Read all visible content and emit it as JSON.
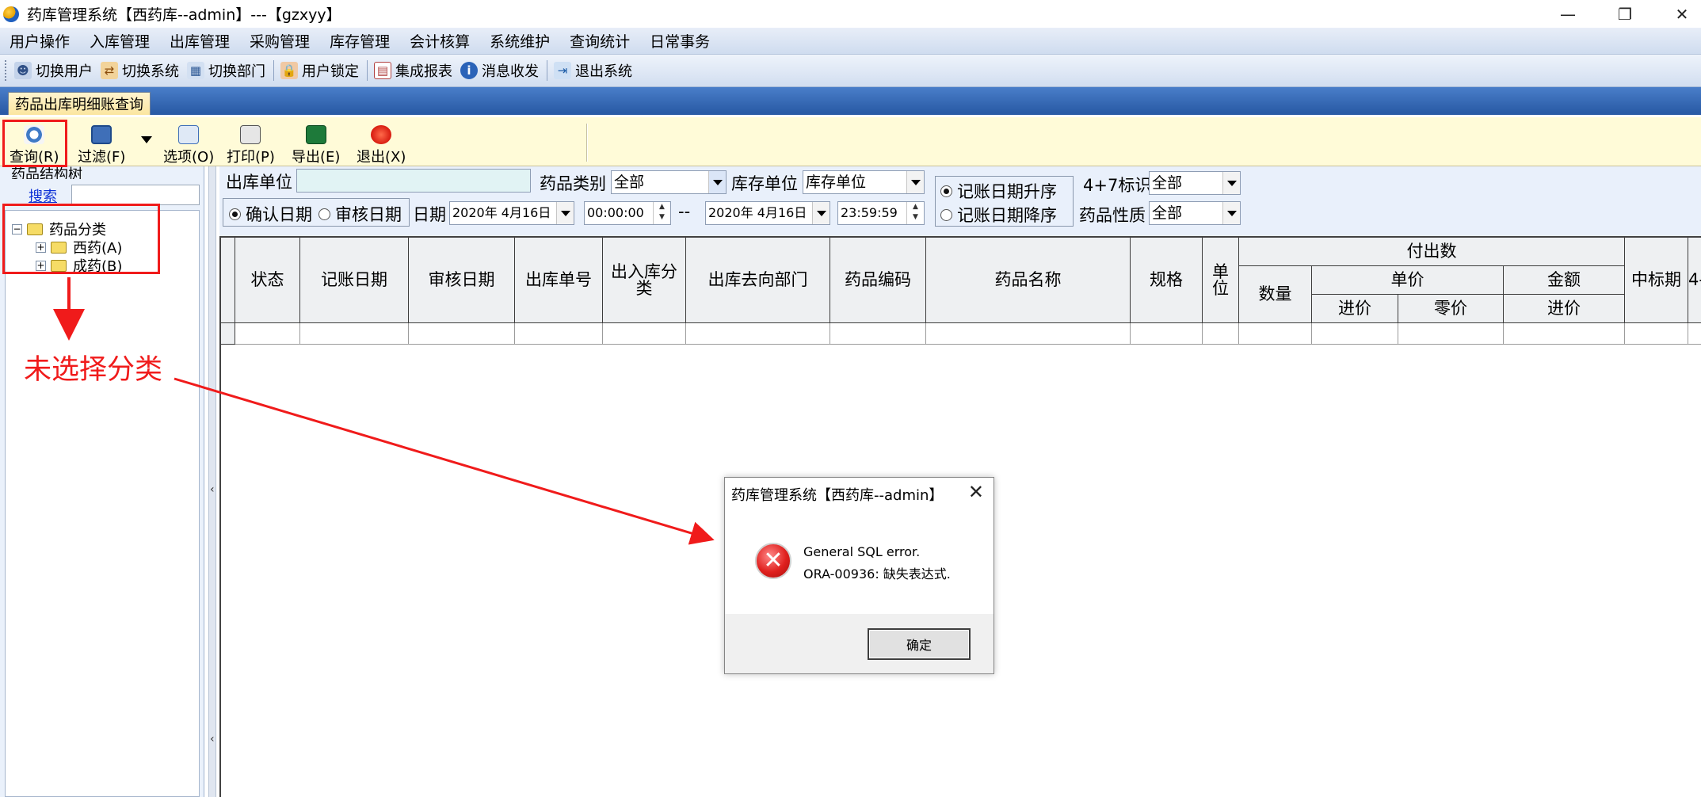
{
  "window": {
    "title": "药库管理系统【西药库--admin】---【gzxyy】",
    "controls": {
      "minimize": "—",
      "maximize": "❐",
      "close": "✕"
    }
  },
  "menu": [
    "用户操作",
    "入库管理",
    "出库管理",
    "采购管理",
    "库存管理",
    "会计核算",
    "系统维护",
    "查询统计",
    "日常事务"
  ],
  "toolbar": [
    {
      "label": "切换用户",
      "icon": "users-icon",
      "color": "#5b7bb5"
    },
    {
      "label": "切换系统",
      "icon": "switch-system-icon",
      "color": "#d48a1a"
    },
    {
      "label": "切换部门",
      "icon": "switch-department-icon",
      "color": "#4d79b6"
    },
    {
      "label": "用户锁定",
      "icon": "user-lock-icon",
      "color": "#c96a24"
    },
    {
      "label": "集成报表",
      "icon": "report-icon",
      "color": "#c33b3b"
    },
    {
      "label": "消息收发",
      "icon": "info-icon",
      "color": "#2b63b8"
    },
    {
      "label": "退出系统",
      "icon": "exit-icon",
      "color": "#3a78c2"
    }
  ],
  "tab": {
    "label": "药品出库明细账查询"
  },
  "actions": {
    "query": "查询(R)",
    "filter": "过滤(F)",
    "options": "选项(O)",
    "print": "打印(P)",
    "export": "导出(E)",
    "exit": "退出(X)"
  },
  "left_panel": {
    "title": "药品结构树",
    "search_link": "搜索",
    "search_value": "",
    "tree": [
      {
        "label": "药品分类",
        "toggle": "−",
        "level": 0
      },
      {
        "label": "西药(A)",
        "toggle": "+",
        "level": 1
      },
      {
        "label": "成药(B)",
        "toggle": "+",
        "level": 1
      }
    ]
  },
  "filters": {
    "dept_label": "出库单位",
    "dept_value": "",
    "category_label": "药品类别",
    "category_value": "全部",
    "unit_label": "库存单位",
    "unit_value": "库存单位",
    "confirm_date": "确认日期",
    "audit_date": "审核日期",
    "date_label": "日期",
    "date_from": "2020年 4月16日",
    "time_from": "00:00:00",
    "range_sep": "--",
    "date_to": "2020年 4月16日",
    "time_to": "23:59:59",
    "sort_asc": "记账日期升序",
    "sort_desc": "记账日期降序",
    "flag_label": "4+7标识",
    "flag_value": "全部",
    "nature_label": "药品性质",
    "nature_value": "全部"
  },
  "grid": {
    "columns": [
      "状态",
      "记账日期",
      "审核日期",
      "出库单号",
      "出入库分类",
      "出库去向部门",
      "药品编码",
      "药品名称",
      "规格",
      "单位"
    ],
    "group_header": "付出数",
    "sub_quantity": "数量",
    "sub_unit_price": "单价",
    "sub_amount": "金额",
    "sub_purchase": "进价",
    "sub_retail": "零价",
    "sub_amount_purchase": "进价",
    "tail_column": "中标期",
    "tail_cut": "4-"
  },
  "annotation": {
    "text": "未选择分类",
    "color": "#f01b1b"
  },
  "dialog": {
    "title": "药库管理系统【西药库--admin】",
    "close": "✕",
    "icon": "error-icon",
    "message_line1": "General SQL error.",
    "message_line2": "ORA-00936: 缺失表达式.",
    "ok": "确定"
  }
}
